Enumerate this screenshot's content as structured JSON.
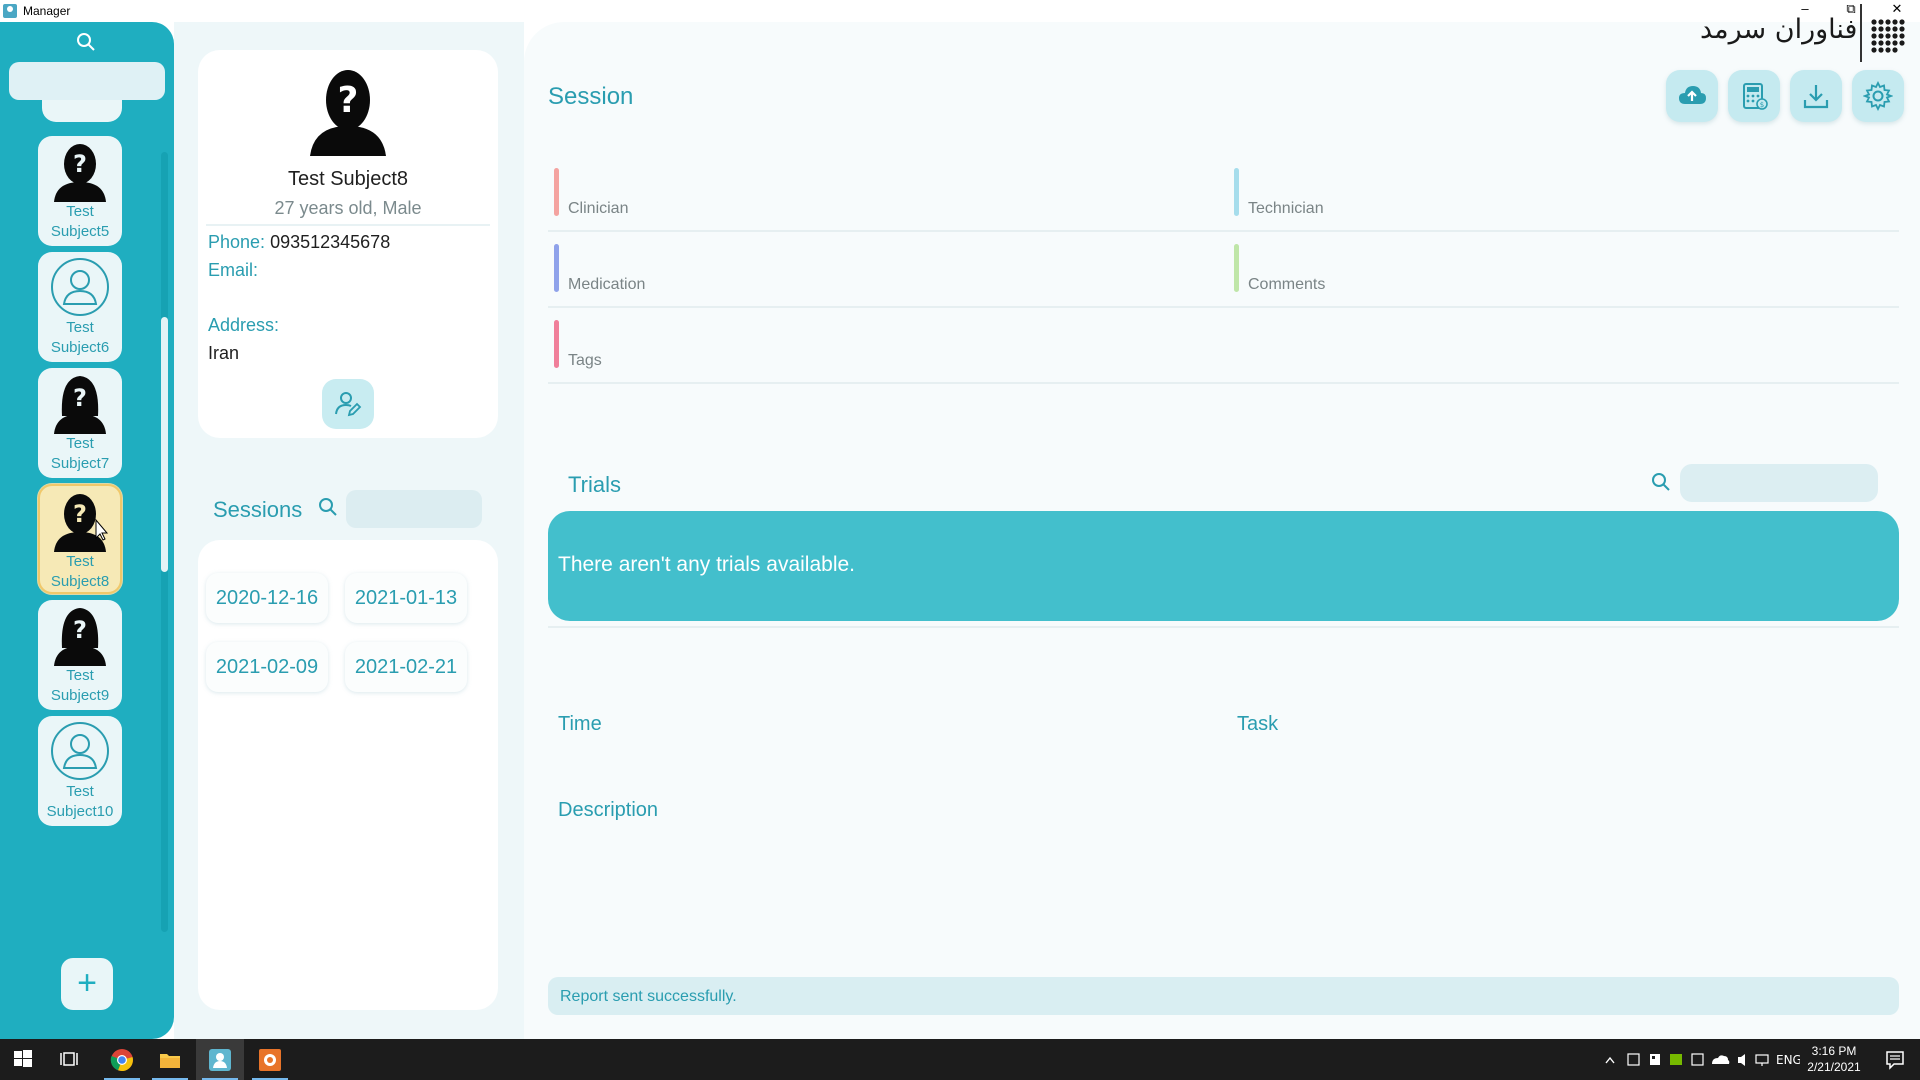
{
  "window": {
    "title": "Manager"
  },
  "brand": {
    "name": "فناوران سرمد"
  },
  "sidebar": {
    "subjects": [
      {
        "line1": "Test",
        "line2": "Subject5",
        "avatar": "unknown-silhouette",
        "active": false
      },
      {
        "line1": "Test",
        "line2": "Subject6",
        "avatar": "default-user",
        "active": false
      },
      {
        "line1": "Test",
        "line2": "Subject7",
        "avatar": "unknown-silhouette-female",
        "active": false
      },
      {
        "line1": "Test",
        "line2": "Subject8",
        "avatar": "unknown-silhouette",
        "active": true
      },
      {
        "line1": "Test",
        "line2": "Subject9",
        "avatar": "unknown-silhouette-female",
        "active": false
      },
      {
        "line1": "Test",
        "line2": "Subject10",
        "avatar": "default-user",
        "active": false
      }
    ],
    "add_label": "+"
  },
  "profile": {
    "name": "Test Subject8",
    "meta": "27 years old, Male",
    "phone_label": "Phone:",
    "phone": "093512345678",
    "email_label": "Email:",
    "email": "",
    "address_label": "Address:",
    "address": "Iran"
  },
  "sessions": {
    "heading": "Sessions",
    "dates": [
      "2020-12-16",
      "2021-01-13",
      "2021-02-09",
      "2021-02-21"
    ]
  },
  "session": {
    "title": "Session",
    "fields": {
      "clinician": "Clinician",
      "technician": "Technician",
      "medication": "Medication",
      "comments": "Comments",
      "tags": "Tags"
    },
    "field_colors": {
      "clinician": "#f4a3a0",
      "technician": "#a6ddec",
      "medication": "#8fa2ea",
      "comments": "#bfe6a8",
      "tags": "#f07f9a"
    }
  },
  "toolbar": {
    "icons": [
      "cloud-upload-icon",
      "calculator-icon",
      "download-icon",
      "settings-icon"
    ]
  },
  "trials": {
    "title": "Trials",
    "empty_message": "There aren't any trials available."
  },
  "trial_detail": {
    "time_label": "Time",
    "task_label": "Task",
    "description_label": "Description"
  },
  "status": {
    "message": "Report sent successfully."
  },
  "taskbar": {
    "time": "3:16 PM",
    "date": "2/21/2021",
    "lang": "ENG"
  },
  "colors": {
    "accent": "#1faec0",
    "accent_text": "#2a9db0",
    "banner": "#43bfcc",
    "active_card": "#f6e9b6"
  }
}
